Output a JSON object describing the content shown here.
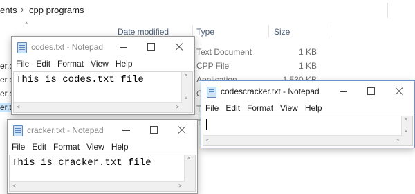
{
  "explorer": {
    "breadcrumb": [
      "ents",
      "cpp programs"
    ],
    "columns": {
      "date_modified": "Date modified",
      "type": "Type",
      "size": "Size"
    },
    "rows": [
      {
        "type": "Text Document",
        "size": "1 KB"
      },
      {
        "type": "CPP File",
        "size": "1 KB"
      },
      {
        "type": "Application",
        "size": "1,530 KB"
      },
      {
        "type": "O",
        "size": ""
      },
      {
        "type": "Te",
        "size": ""
      },
      {
        "type": "Te",
        "size": ""
      }
    ],
    "left_fragments": [
      "er.c",
      "er.e",
      "er.o",
      "er.t"
    ]
  },
  "notepad_codes": {
    "title": "codes.txt - Notepad",
    "menu": [
      "File",
      "Edit",
      "Format",
      "View",
      "Help"
    ],
    "content": "This is codes.txt file"
  },
  "notepad_cracker": {
    "title": "cracker.txt - Notepad",
    "menu": [
      "File",
      "Edit",
      "Format",
      "View",
      "Help"
    ],
    "content": "This is cracker.txt file"
  },
  "notepad_codescracker": {
    "title": "codescracker.txt - Notepad",
    "menu": [
      "File",
      "Edit",
      "Format",
      "View",
      "Help"
    ],
    "content": ""
  },
  "icons": [
    "notepad-icon",
    "minimize-icon",
    "maximize-icon",
    "close-icon"
  ]
}
